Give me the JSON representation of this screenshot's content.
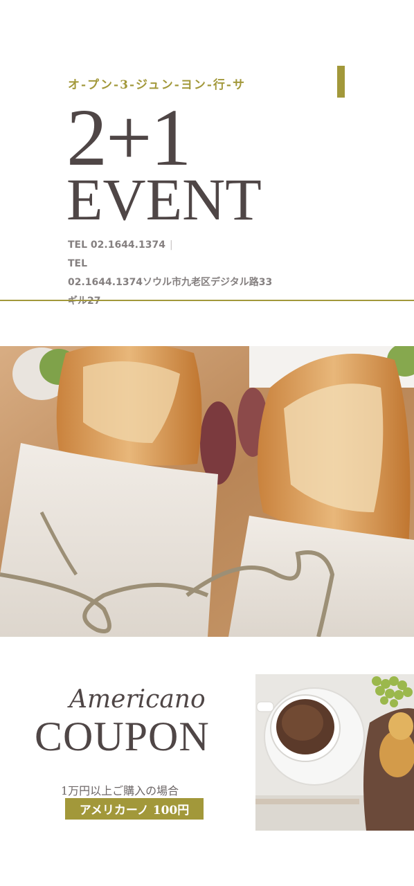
{
  "header": {
    "subtitle": "オ-プン-3-ジュン-ヨン-行-サ",
    "headline_number": "2+1",
    "headline_word": "EVENT",
    "contact_line1": "TEL 02.1644.1374",
    "contact_line2": "TEL",
    "contact_line3": "02.1644.1374ソウル市九老区デジタル路33",
    "contact_line4": "ギル27"
  },
  "hero_image": {
    "subject": "baguette sandwiches wrapped in paper"
  },
  "coupon": {
    "script_title": "Americano",
    "title": "COUPON",
    "condition": "1万円以上ご購入の場合",
    "offer": "アメリカーノ 100円"
  },
  "coupon_image": {
    "subject": "coffee cup with bread and grapes"
  },
  "colors": {
    "accent": "#a2983a",
    "text_dark": "#4f4646",
    "text_muted": "#858080"
  }
}
